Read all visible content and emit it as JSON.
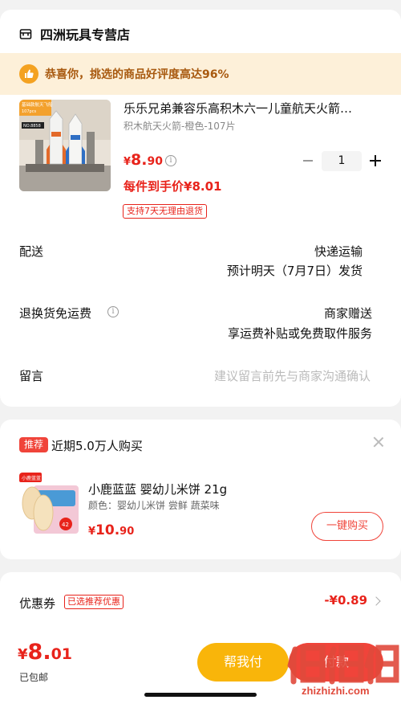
{
  "store": {
    "name": "四洲玩具专营店",
    "praise": "恭喜你，挑选的商品好评度高达96%"
  },
  "product": {
    "title": "乐乐兄弟兼容乐高积木六一儿童航天火箭…",
    "spec": "积木航天火箭-橙色-107片",
    "price_currency": "¥",
    "price_int": "8.",
    "price_dec": "90",
    "info_icon": "info-icon",
    "deal_price": "每件到手价¥8.01",
    "return_badge": "支持7天无理由退货",
    "quantity": "1",
    "box_label_1": "基础款航天飞船",
    "box_label_2": "107pcs",
    "box_label_3": "NO.8858"
  },
  "rows": {
    "delivery_label": "配送",
    "delivery_method": "快递运输",
    "delivery_eta": "预计明天（7月7日）发货",
    "return_label": "退换货免运费",
    "return_value_1": "商家赠送",
    "return_value_2": "享运费补贴或免费取件服务",
    "message_label": "留言",
    "message_placeholder": "建议留言前先与商家沟通确认"
  },
  "recommend": {
    "tag": "推荐",
    "title": "近期5.0万人购买",
    "name": "小鹿蓝蓝 婴幼儿米饼 21g",
    "options": "颜色：婴幼儿米饼 尝鲜 蔬菜味",
    "price_currency": "¥",
    "price_int": "10.",
    "price_dec": "90",
    "buy_label": "一键购买",
    "img_badge": "小鹿蓝蓝",
    "img_badge_2": "42"
  },
  "coupon": {
    "label": "优惠券",
    "badge": "已选推荐优惠",
    "value": "-¥0.89"
  },
  "bottom": {
    "total_currency": "¥",
    "total_int": "8.",
    "total_dec": "01",
    "shipping": "已包邮",
    "help_label": "帮我付",
    "pay_label": "付款"
  },
  "watermark": {
    "text": "zhizhizhi.com"
  },
  "colors": {
    "accent_red": "#e8231b",
    "accent_orange": "#f9b50a",
    "praise_bg": "#fdf0d9"
  }
}
